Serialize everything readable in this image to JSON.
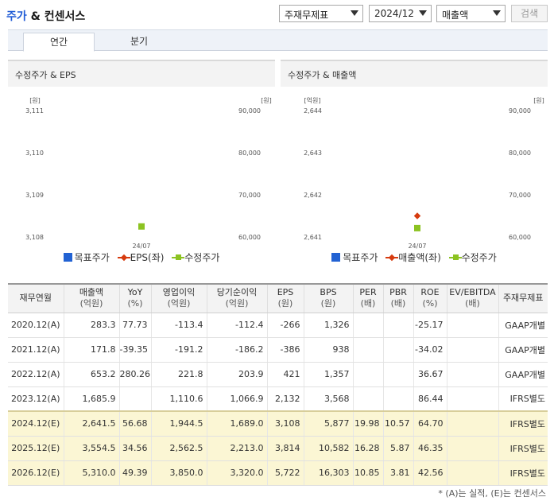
{
  "header": {
    "title_main": "주가",
    "title_rest": " & 컨센서스",
    "select_standard": "주재무제표",
    "select_period": "2024/12",
    "select_item": "매출액",
    "search_label": "검색"
  },
  "tabs": [
    {
      "label": "연간",
      "active": true
    },
    {
      "label": "분기",
      "active": false
    }
  ],
  "charts": [
    {
      "title": "수정주가 & EPS",
      "left_unit": "[원]",
      "right_unit": "[원]",
      "left_ticks": [
        "3,111",
        "3,110",
        "3,109",
        "3,108"
      ],
      "right_ticks": [
        "90,000",
        "80,000",
        "70,000",
        "60,000"
      ],
      "x_label": "24/07",
      "legend": [
        "목표주가",
        "EPS(좌)",
        "수정주가"
      ]
    },
    {
      "title": "수정주가 & 매출액",
      "left_unit": "[억원]",
      "right_unit": "[원]",
      "left_ticks": [
        "2,644",
        "2,643",
        "2,642",
        "2,641"
      ],
      "right_ticks": [
        "90,000",
        "80,000",
        "70,000",
        "60,000"
      ],
      "x_label": "24/07",
      "legend": [
        "목표주가",
        "매출액(좌)",
        "수정주가"
      ]
    }
  ],
  "chart_data": [
    {
      "type": "line",
      "title": "수정주가 & EPS",
      "categories": [
        "24/07"
      ],
      "left_axis": {
        "unit": "[원]",
        "ylim": [
          3108,
          3111
        ]
      },
      "right_axis": {
        "unit": "[원]",
        "ylim": [
          60000,
          90000
        ]
      },
      "series": [
        {
          "name": "목표주가",
          "axis": "right",
          "values": [
            null
          ],
          "color": "#2262d3"
        },
        {
          "name": "EPS(좌)",
          "axis": "left",
          "values": [
            null
          ],
          "color": "#d63b0f"
        },
        {
          "name": "수정주가",
          "axis": "right",
          "values": [
            62500
          ],
          "color": "#8cc321"
        }
      ],
      "legend": "bottom"
    },
    {
      "type": "line",
      "title": "수정주가 & 매출액",
      "categories": [
        "24/07"
      ],
      "left_axis": {
        "unit": "[억원]",
        "ylim": [
          2641,
          2644
        ]
      },
      "right_axis": {
        "unit": "[원]",
        "ylim": [
          60000,
          90000
        ]
      },
      "series": [
        {
          "name": "목표주가",
          "axis": "right",
          "values": [
            null
          ],
          "color": "#2262d3"
        },
        {
          "name": "매출액(좌)",
          "axis": "left",
          "values": [
            2641.5
          ],
          "color": "#d63b0f"
        },
        {
          "name": "수정주가",
          "axis": "right",
          "values": [
            62100
          ],
          "color": "#8cc321"
        }
      ],
      "legend": "bottom"
    }
  ],
  "table": {
    "headers": [
      [
        "재무연월",
        ""
      ],
      [
        "매출액",
        "(억원)"
      ],
      [
        "YoY",
        "(%)"
      ],
      [
        "영업이익",
        "(억원)"
      ],
      [
        "당기순이익",
        "(억원)"
      ],
      [
        "EPS",
        "(원)"
      ],
      [
        "BPS",
        "(원)"
      ],
      [
        "PER",
        "(배)"
      ],
      [
        "PBR",
        "(배)"
      ],
      [
        "ROE",
        "(%)"
      ],
      [
        "EV/EBITDA",
        "(배)"
      ],
      [
        "주재무제표",
        ""
      ]
    ],
    "rows": [
      {
        "est": false,
        "cells": [
          "2020.12(A)",
          "283.3",
          "77.73",
          "-113.4",
          "-112.4",
          "-266",
          "1,326",
          "",
          "",
          "-25.17",
          "",
          "GAAP개별"
        ]
      },
      {
        "est": false,
        "cells": [
          "2021.12(A)",
          "171.8",
          "-39.35",
          "-191.2",
          "-186.2",
          "-386",
          "938",
          "",
          "",
          "-34.02",
          "",
          "GAAP개별"
        ]
      },
      {
        "est": false,
        "cells": [
          "2022.12(A)",
          "653.2",
          "280.26",
          "221.8",
          "203.9",
          "421",
          "1,357",
          "",
          "",
          "36.67",
          "",
          "GAAP개별"
        ]
      },
      {
        "est": false,
        "cells": [
          "2023.12(A)",
          "1,685.9",
          "",
          "1,110.6",
          "1,066.9",
          "2,132",
          "3,568",
          "",
          "",
          "86.44",
          "",
          "IFRS별도"
        ]
      },
      {
        "est": true,
        "cells": [
          "2024.12(E)",
          "2,641.5",
          "56.68",
          "1,944.5",
          "1,689.0",
          "3,108",
          "5,877",
          "19.98",
          "10.57",
          "64.70",
          "",
          "IFRS별도"
        ]
      },
      {
        "est": true,
        "cells": [
          "2025.12(E)",
          "3,554.5",
          "34.56",
          "2,562.5",
          "2,213.0",
          "3,814",
          "10,582",
          "16.28",
          "5.87",
          "46.35",
          "",
          "IFRS별도"
        ]
      },
      {
        "est": true,
        "cells": [
          "2026.12(E)",
          "5,310.0",
          "49.39",
          "3,850.0",
          "3,320.0",
          "5,722",
          "16,303",
          "10.85",
          "3.81",
          "42.56",
          "",
          "IFRS별도"
        ]
      }
    ]
  },
  "footnote": "* (A)는 실적, (E)는 컨센서스",
  "colors": {
    "accent": "#1f5bd6",
    "target_price": "#2262d3",
    "left_series": "#d63b0f",
    "adjusted_price": "#8cc321",
    "estimate_row": "#fbf6d4"
  }
}
